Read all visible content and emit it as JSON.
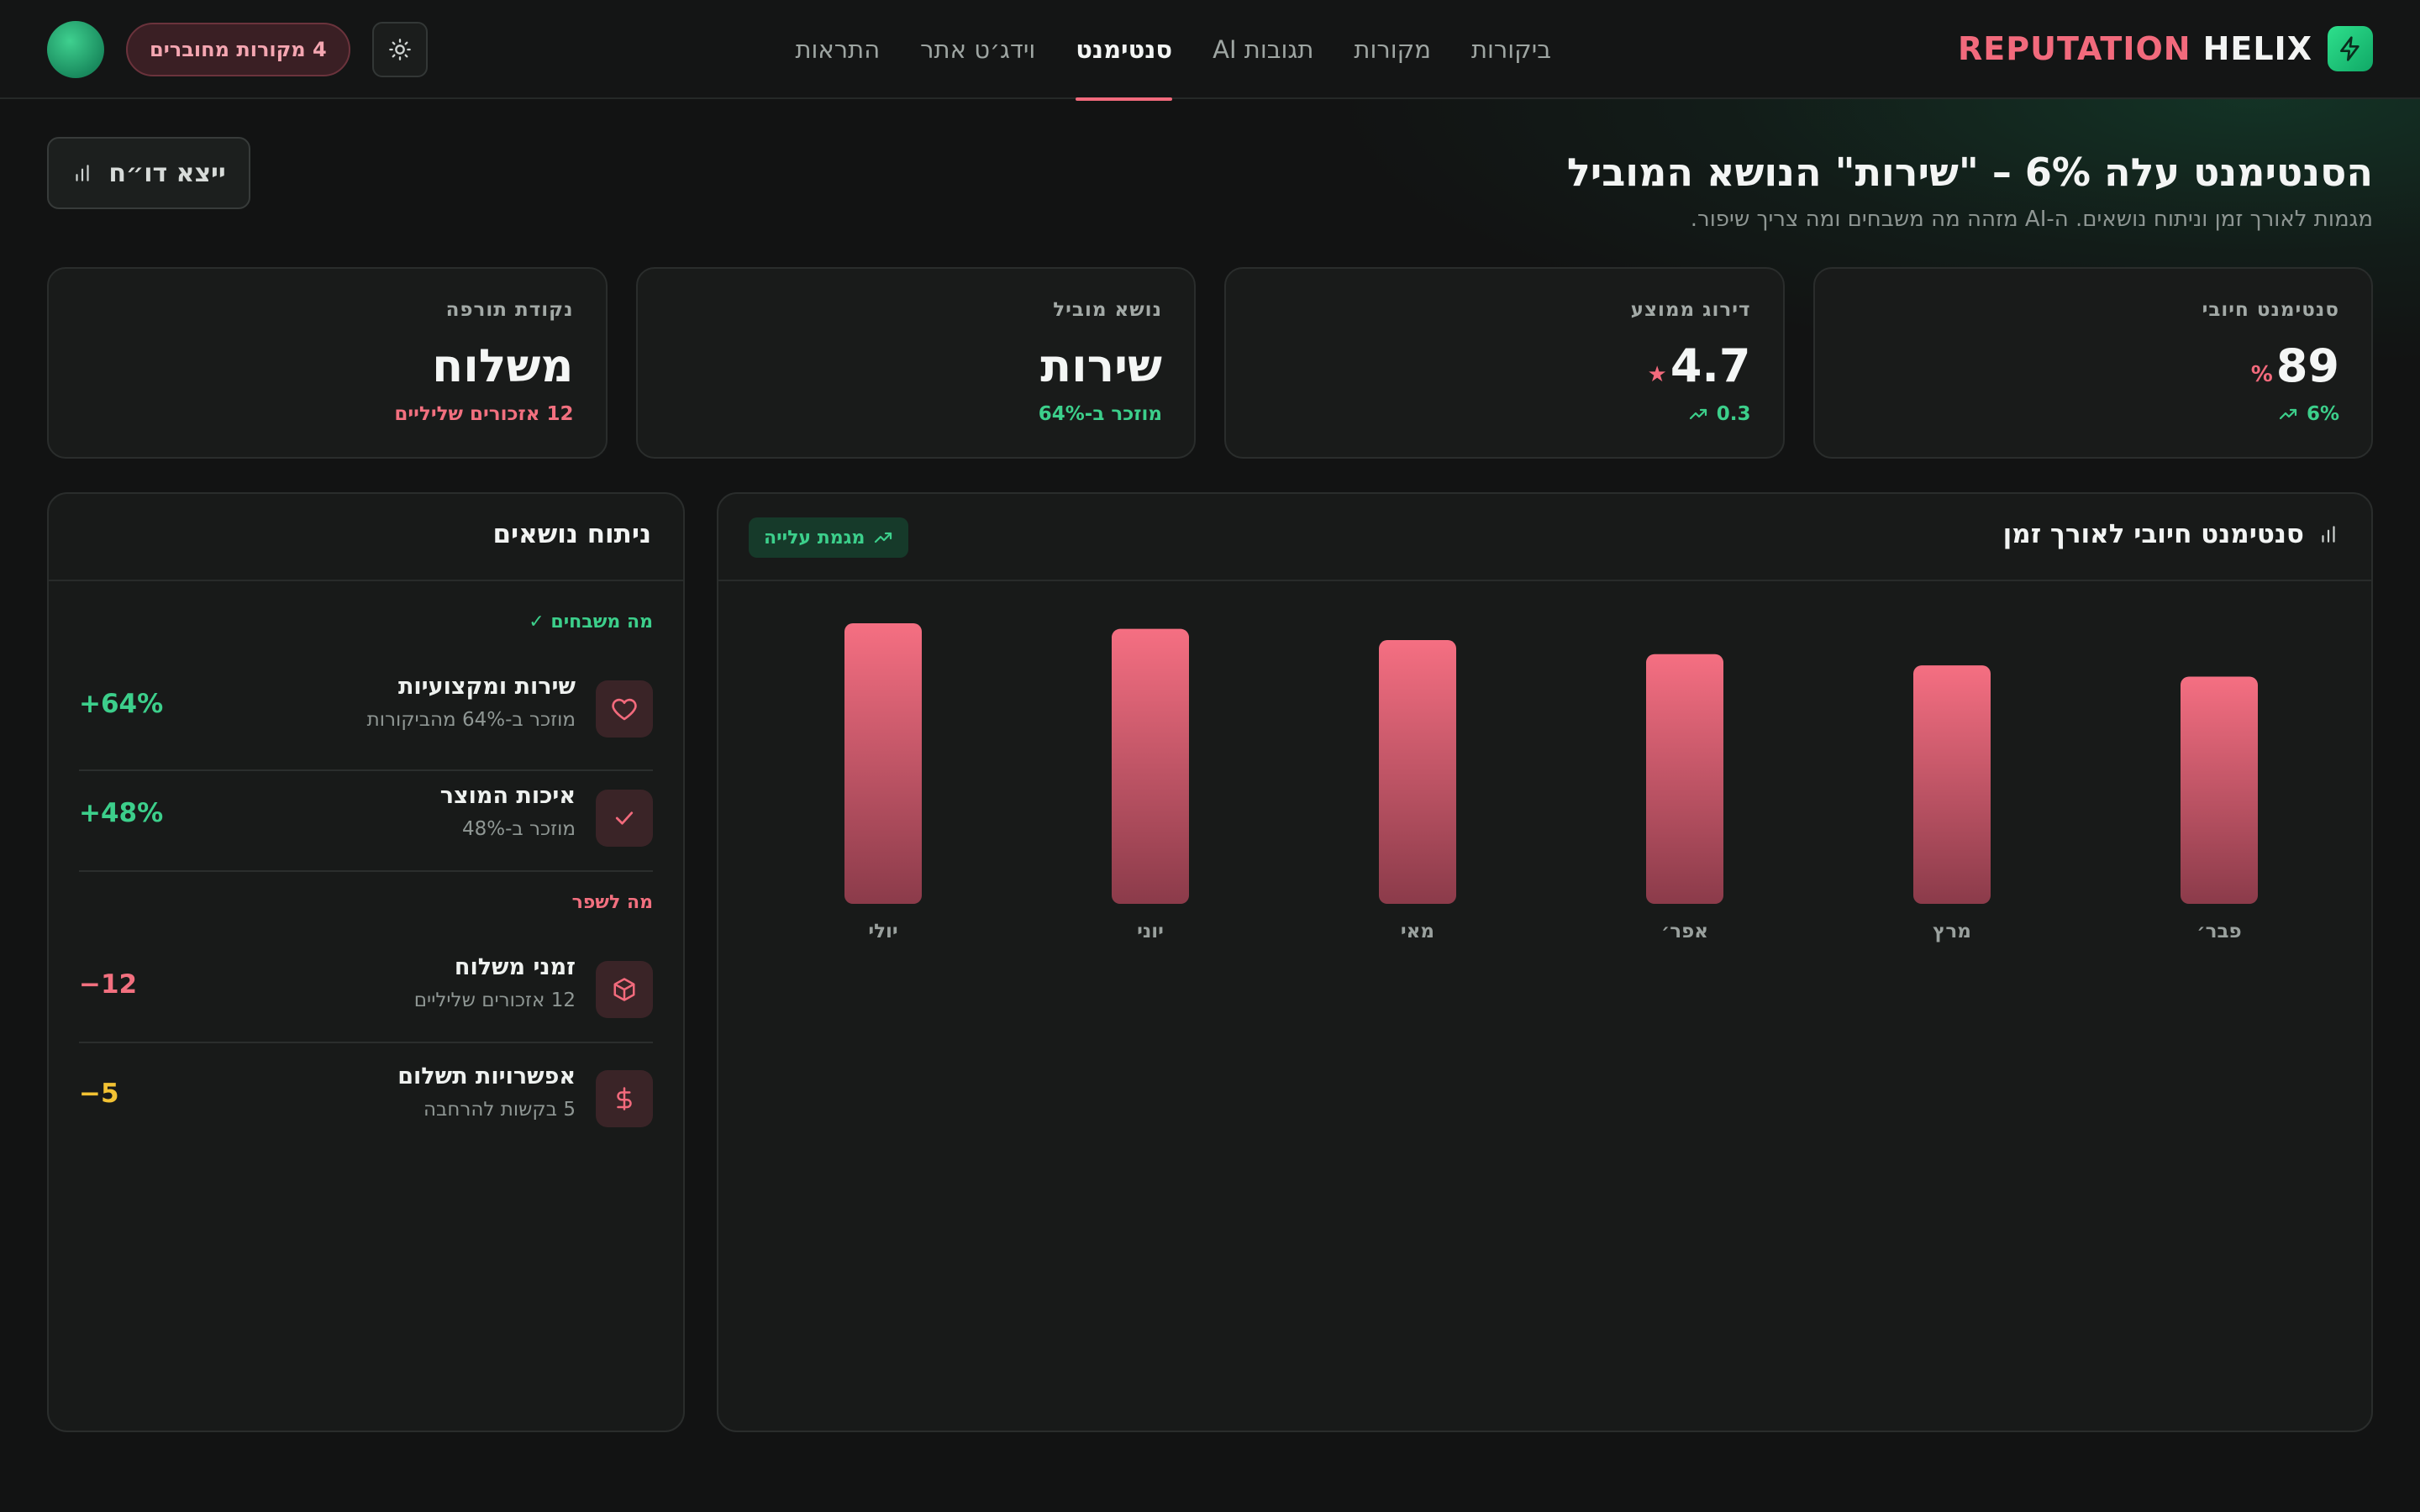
{
  "brand": {
    "name_a": "REPUTATION",
    "name_b": "HELIX"
  },
  "nav": [
    {
      "label": "ביקורות",
      "active": false
    },
    {
      "label": "מקורות",
      "active": false
    },
    {
      "label": "תגובות AI",
      "active": false
    },
    {
      "label": "סנטימנט",
      "active": true
    },
    {
      "label": "וידג׳ט אתר",
      "active": false
    },
    {
      "label": "התראות",
      "active": false
    }
  ],
  "header": {
    "sources_pill": "4 מקורות מחוברים",
    "theme_icon": "sun-icon"
  },
  "hero": {
    "title": "הסנטימנט עלה 6% – \"שירות\" הנושא המוביל",
    "subtitle": "מגמות לאורך זמן וניתוח נושאים. ה-AI מזהה מה משבחים ומה צריך שיפור.",
    "export_label": "ייצא דו״ח"
  },
  "kpis": [
    {
      "label": "סנטימנט חיובי",
      "value": "89",
      "unit": "%",
      "sub": "6%",
      "sub_tone": "green",
      "trend": "up"
    },
    {
      "label": "דירוג ממוצע",
      "value": "4.7",
      "unit": "★",
      "sub": "0.3",
      "sub_tone": "green",
      "trend": "up"
    },
    {
      "label": "נושא מוביל",
      "value": "שירות",
      "unit": "",
      "sub": "מוזכר ב-64%",
      "sub_tone": "green",
      "trend": ""
    },
    {
      "label": "נקודת תורפה",
      "value": "משלוח",
      "unit": "",
      "sub": "12 אזכורים שליליים",
      "sub_tone": "red",
      "trend": ""
    }
  ],
  "chart_panel": {
    "title": "סנטימנט חיובי לאורך זמן",
    "badge": "מגמת עלייה"
  },
  "chart_data": {
    "type": "bar",
    "categories": [
      "פבר׳",
      "מרץ",
      "אפר׳",
      "מאי",
      "יוני",
      "יולי"
    ],
    "values": [
      81,
      85,
      89,
      94,
      98,
      100
    ],
    "title": "סנטימנט חיובי לאורך זמן",
    "xlabel": "",
    "ylabel": "",
    "ylim": [
      0,
      100
    ],
    "grid": false,
    "colors": {
      "bar_top": "#f56f82",
      "bar_bottom": "#8b3b4a"
    }
  },
  "topics": {
    "title": "ניתוח נושאים",
    "praise_label": "מה משבחים ✓",
    "improve_label": "מה לשפר",
    "praise": [
      {
        "name": "שירות ומקצועיות",
        "desc": "מוזכר ב-64% מהביקורות",
        "score": "+64%",
        "icon": "heart-icon"
      },
      {
        "name": "איכות המוצר",
        "desc": "מוזכר ב-48%",
        "score": "+48%",
        "icon": "check-icon"
      }
    ],
    "improve": [
      {
        "name": "זמני משלוח",
        "desc": "12 אזכורים שליליים",
        "score": "−12",
        "icon": "box-icon",
        "tone": "red"
      },
      {
        "name": "אפשרויות תשלום",
        "desc": "5 בקשות להרחבה",
        "score": "−5",
        "icon": "dollar-icon",
        "tone": "yellow"
      }
    ]
  }
}
